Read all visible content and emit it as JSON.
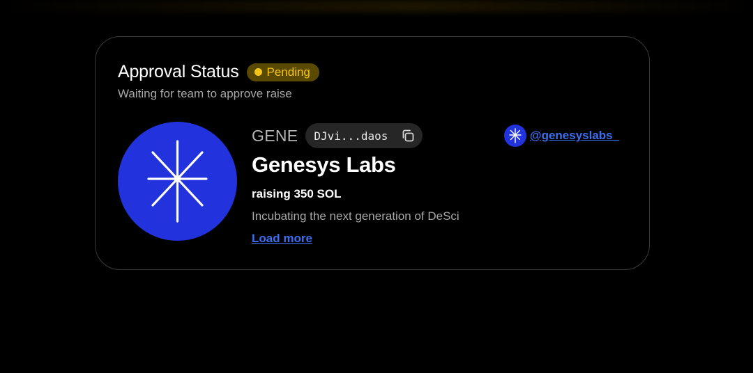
{
  "approval": {
    "title": "Approval Status",
    "status": "Pending",
    "subtitle": "Waiting for team to approve raise"
  },
  "project": {
    "ticker": "GENE",
    "address": "DJvi...daos",
    "name": "Genesys Labs",
    "raising": "raising 350 SOL",
    "description": "Incubating the next generation of DeSci",
    "load_more": "Load more",
    "social_handle": "@genesyslabs_",
    "logo_icon": "asterisk-star-icon",
    "copy_icon": "copy-icon"
  },
  "colors": {
    "background": "#000000",
    "card_border": "#3a3a3a",
    "badge_bg": "#5a4a00",
    "badge_text": "#f5c518",
    "logo_blue": "#2233dd",
    "link_blue": "#3b6ef0",
    "muted_text": "#a8a8a8",
    "pill_bg": "#262626"
  }
}
